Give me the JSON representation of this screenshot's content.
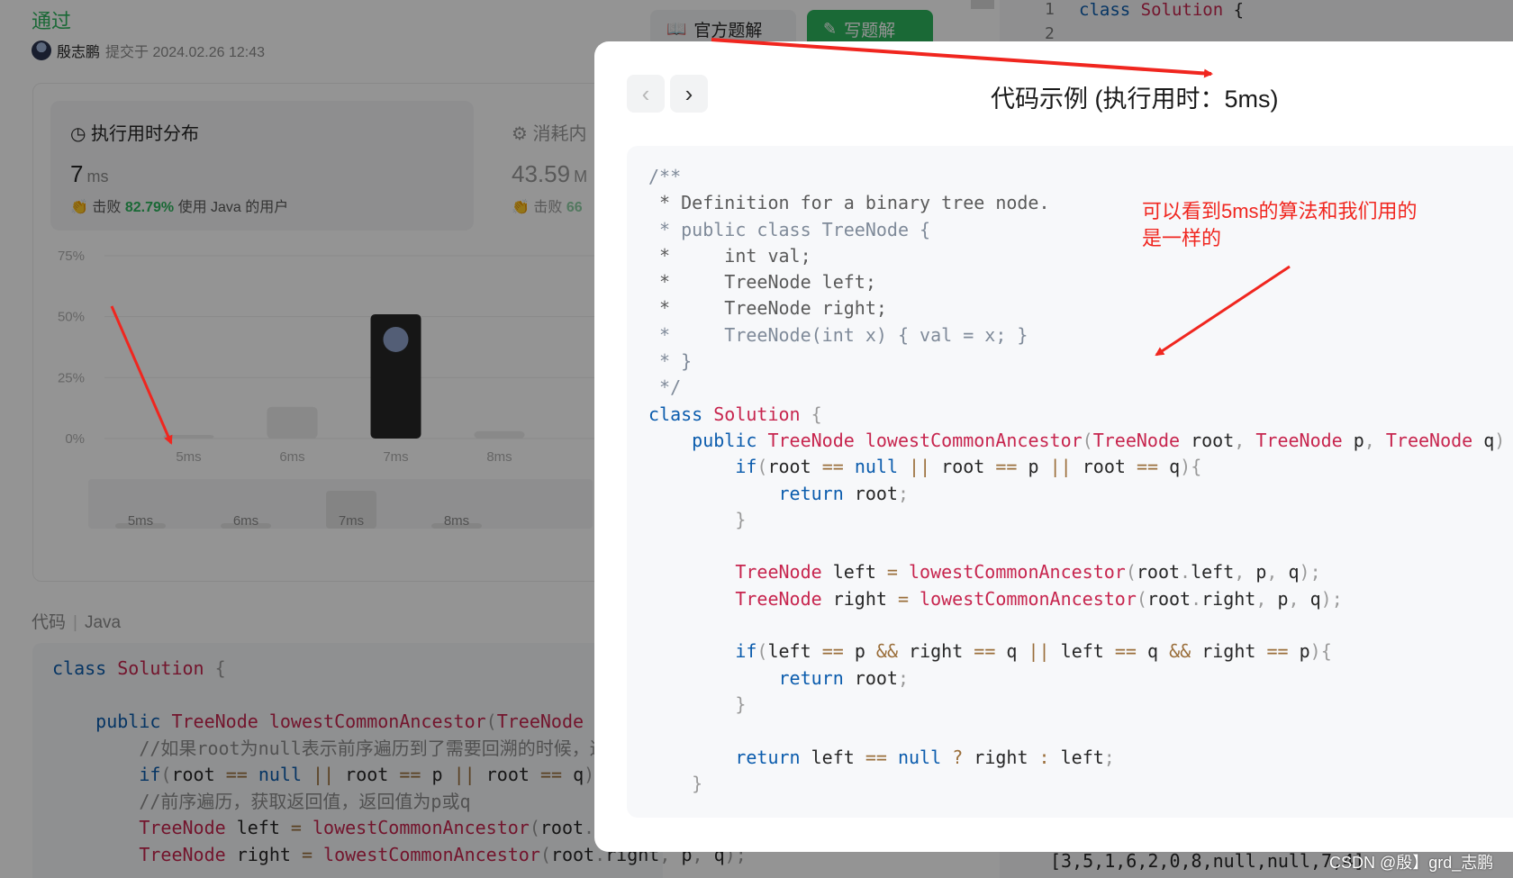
{
  "submission": {
    "status": "通过",
    "username": "殷志鹏",
    "submitted_text": "提交于 2024.02.26 12:43"
  },
  "header": {
    "official_solution": "官方题解",
    "write_solution": "写题解"
  },
  "runtime": {
    "title": "执行用时分布",
    "value": "7",
    "unit": "ms",
    "beat_prefix": "击败",
    "beat_pct": "82.79%",
    "beat_suffix": "使用 Java 的用户"
  },
  "memory": {
    "title": "消耗内",
    "value": "43.59",
    "unit": "M",
    "beat_prefix": "击败",
    "beat_pct": "66"
  },
  "chart_data": {
    "type": "bar",
    "categories": [
      "5ms",
      "6ms",
      "7ms",
      "8ms"
    ],
    "values": [
      1,
      13,
      51,
      3
    ],
    "highlight_index": 2,
    "yticks": [
      "75%",
      "50%",
      "25%",
      "0%"
    ],
    "ylim": [
      0,
      75
    ],
    "overview_categories": [
      "5ms",
      "6ms",
      "7ms",
      "8ms"
    ],
    "overview_values": [
      2,
      3,
      30,
      3
    ]
  },
  "code_section": {
    "label": "代码",
    "language": "Java",
    "lines": [
      "class Solution {",
      "",
      "    public TreeNode lowestCommonAncestor(TreeNode r",
      "        //如果root为null表示前序遍历到了需要回溯的时候，返",
      "        if(root == null || root == p || root == q)",
      "        //前序遍历，获取返回值，返回值为p或q",
      "        TreeNode left = lowestCommonAncestor(root.l",
      "        TreeNode right = lowestCommonAncestor(root.right, p, q);"
    ]
  },
  "editor": {
    "line_numbers": [
      "1",
      "2"
    ],
    "first_line": "class Solution {",
    "testcase": "[3,5,1,6,2,0,8,null,null,7,4]"
  },
  "modal": {
    "title": "代码示例 (执行用时：5ms)",
    "code_lines": [
      "/**",
      " * Definition for a binary tree node.",
      " * public class TreeNode {",
      " *     int val;",
      " *     TreeNode left;",
      " *     TreeNode right;",
      " *     TreeNode(int x) { val = x; }",
      " * }",
      " */",
      "class Solution {",
      "    public TreeNode lowestCommonAncestor(TreeNode root, TreeNode p, TreeNode q) {",
      "        if(root == null || root == p || root == q){",
      "            return root;",
      "        }",
      "",
      "        TreeNode left = lowestCommonAncestor(root.left, p, q);",
      "        TreeNode right = lowestCommonAncestor(root.right, p, q);",
      "",
      "        if(left == p && right == q || left == q && right == p){",
      "            return root;",
      "        }",
      "",
      "        return left == null ? right : left;",
      "    }"
    ]
  },
  "annotation": {
    "line1": "可以看到5ms的算法和我们用的",
    "line2": "是一样的"
  },
  "watermark": "CSDN @殷】grd_志鹏",
  "colors": {
    "accent_green": "#2db55d",
    "annotation_red": "#f0261f",
    "highlight_bar": "#262626",
    "bar": "#ececec"
  }
}
